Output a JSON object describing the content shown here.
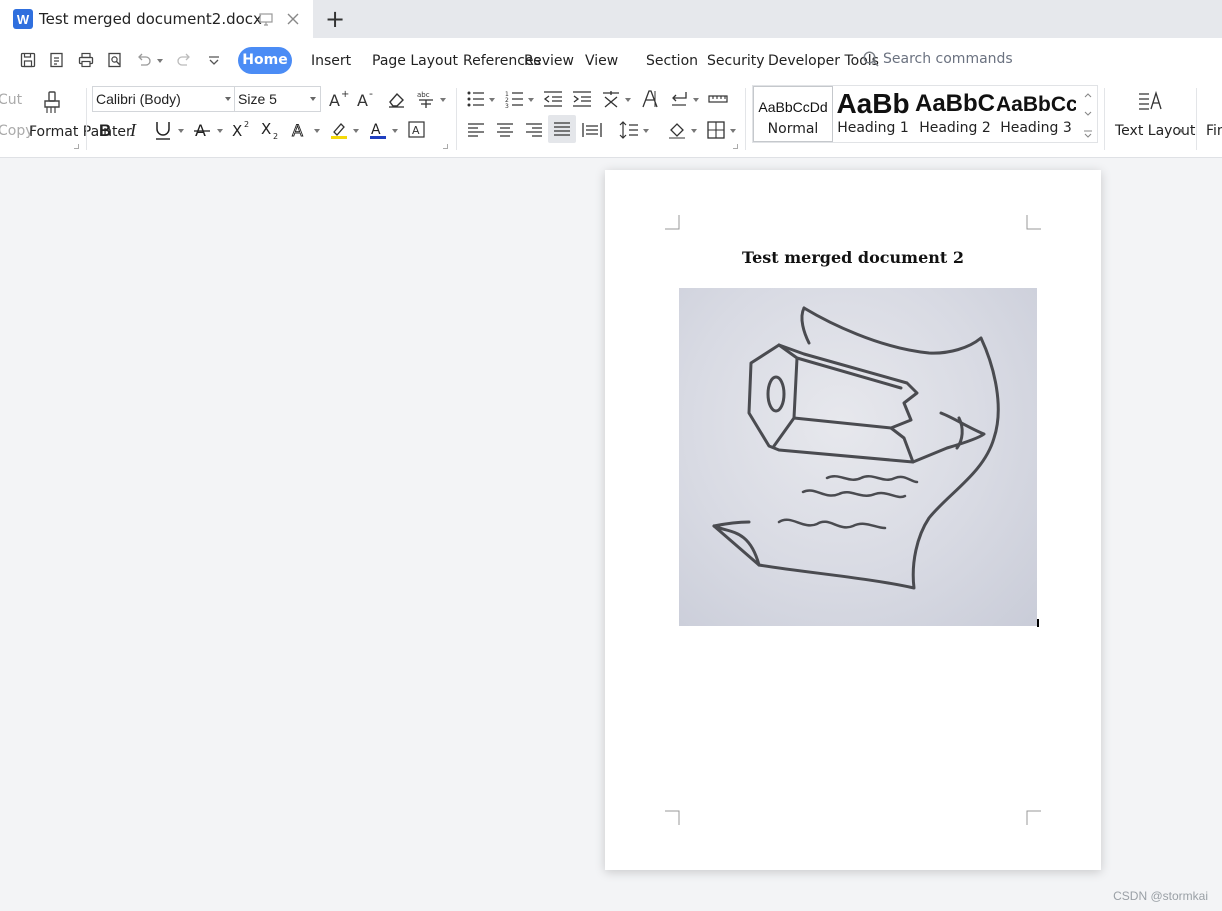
{
  "tab": {
    "title": "Test merged document2.docx",
    "logo_letter": "W",
    "new_tab": "+"
  },
  "menu": {
    "items": [
      "Home",
      "Insert",
      "Page Layout",
      "References",
      "Review",
      "View",
      "Section",
      "Security",
      "Developer Tools"
    ],
    "active_index": 0,
    "search_placeholder": "Search commands"
  },
  "ribbon": {
    "cut_label": "Cut",
    "copy_label": "Copy",
    "format_painter_label": "Format Painter",
    "font_name": "Calibri (Body)",
    "font_size": "Size 5",
    "text_layout_label": "Text Layout",
    "find_label": "Find",
    "styles": [
      {
        "sample": "AaBbCcDd",
        "label": "Normal"
      },
      {
        "sample": "AaBb",
        "label": "Heading 1"
      },
      {
        "sample": "AaBbC",
        "label": "Heading 2"
      },
      {
        "sample": "AaBbCc",
        "label": "Heading 3"
      }
    ]
  },
  "document": {
    "heading": "Test merged document 2",
    "image_icon": "scroll-and-pencil-drawing"
  },
  "watermark": "CSDN @stormkai",
  "colors": {
    "accent": "#4b8cf5",
    "logo": "#2f6fde",
    "highlight": "#f5d90a",
    "font_color": "#1f3fbf"
  }
}
